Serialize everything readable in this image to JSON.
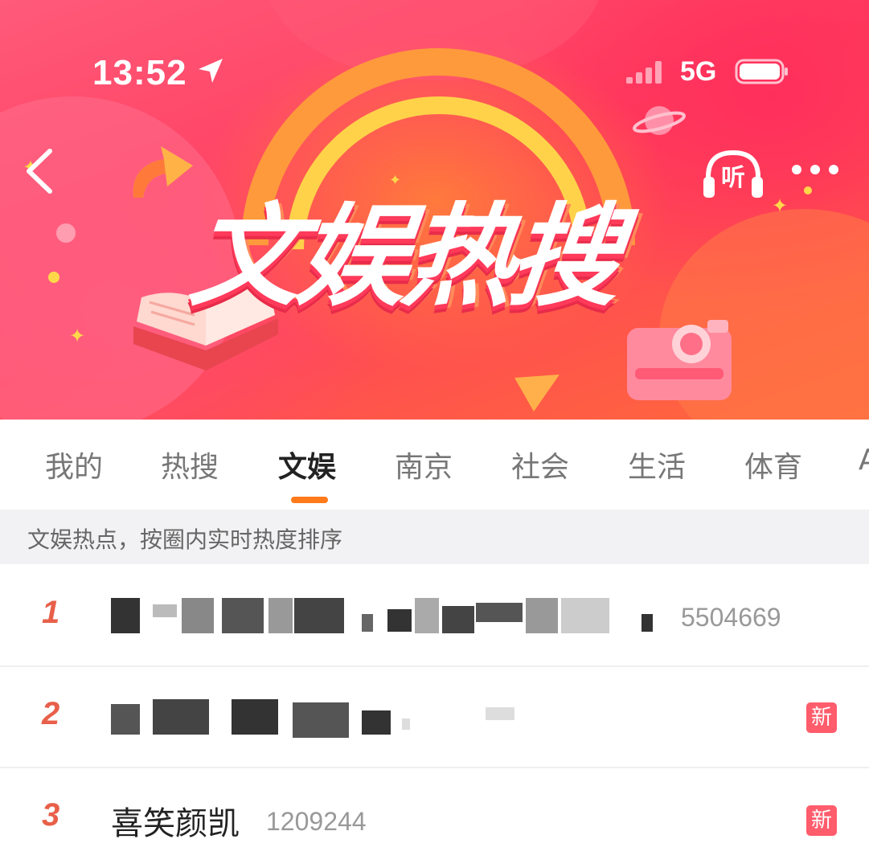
{
  "status_bar": {
    "time": "13:52",
    "network": "5G"
  },
  "banner": {
    "title": "文娱热搜",
    "listen_label": "听"
  },
  "tabs": [
    {
      "label": "我的"
    },
    {
      "label": "热搜"
    },
    {
      "label": "文娱",
      "active": true
    },
    {
      "label": "南京"
    },
    {
      "label": "社会"
    },
    {
      "label": "生活"
    },
    {
      "label": "体育"
    },
    {
      "label": "A"
    }
  ],
  "hint": "文娱热点，按圈内实时热度排序",
  "list": [
    {
      "rank": "1",
      "topic": "",
      "heat": "5504669",
      "blurred": true,
      "badge": ""
    },
    {
      "rank": "2",
      "topic": "",
      "heat": "",
      "blurred": true,
      "badge": "新"
    },
    {
      "rank": "3",
      "topic": "喜笑颜凯",
      "heat": "1209244",
      "blurred": false,
      "badge": "新"
    }
  ],
  "colors": {
    "accent": "#ff7a1a",
    "rank": "#e8604a",
    "badge": "#ff5c6c"
  }
}
